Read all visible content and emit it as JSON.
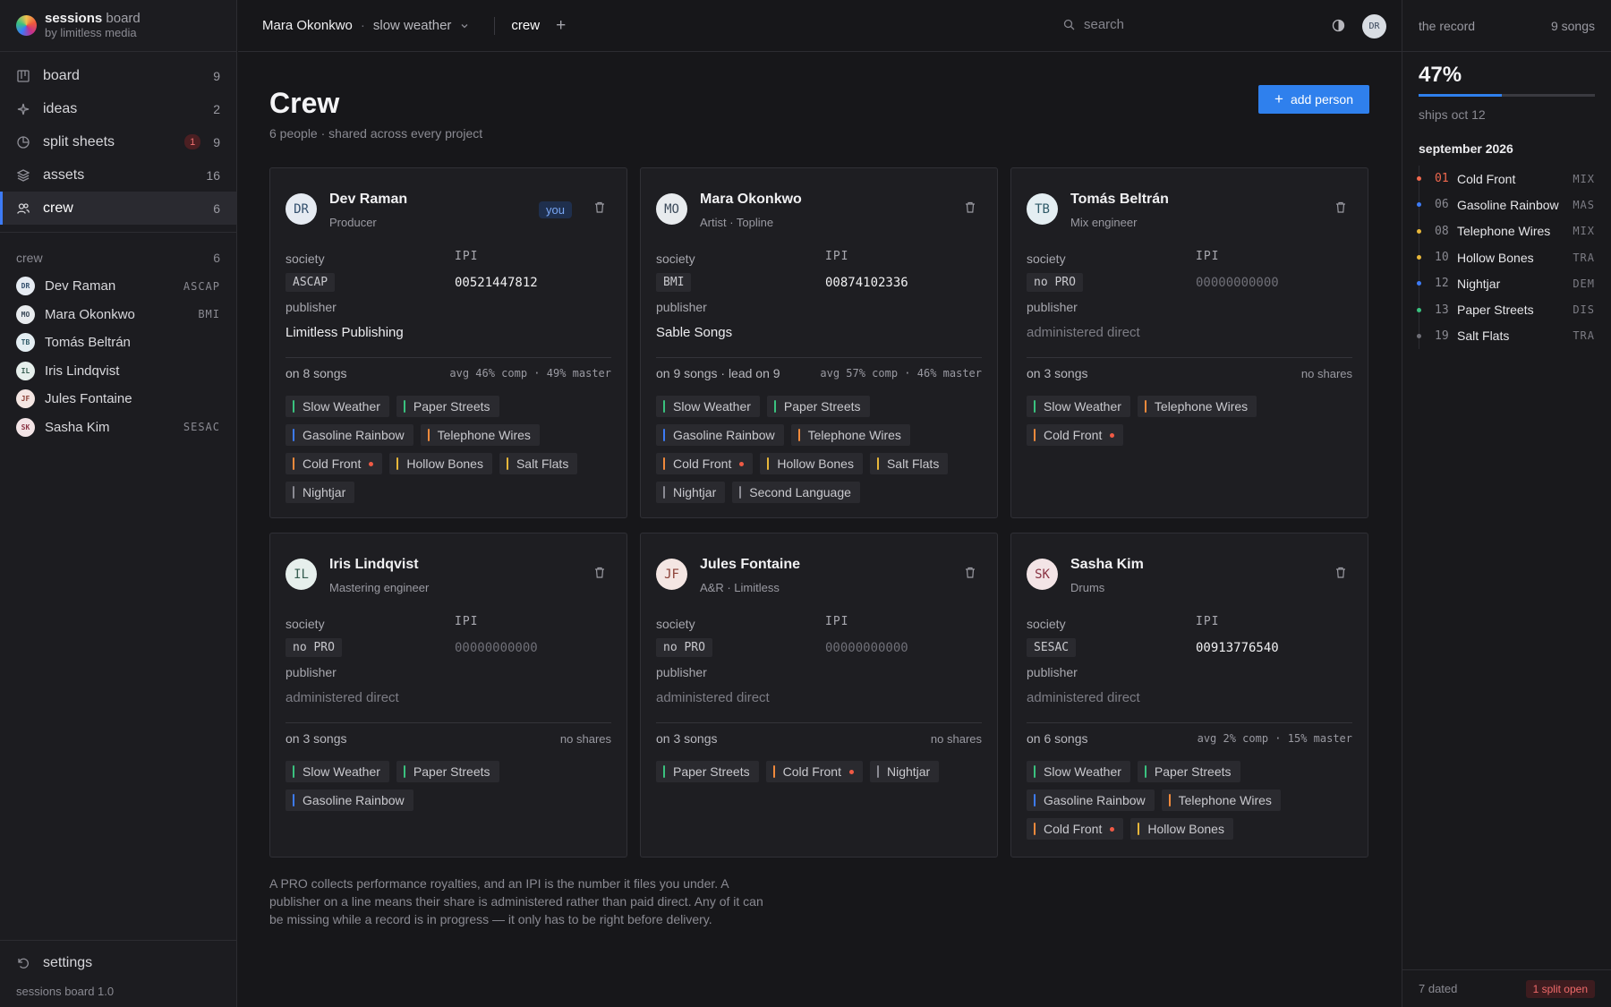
{
  "brand": {
    "name": "sessions",
    "name_suffix": "board",
    "sub": "by limitless media"
  },
  "nav": [
    {
      "key": "board",
      "label": "board",
      "count": "9",
      "icon": "board-icon"
    },
    {
      "key": "ideas",
      "label": "ideas",
      "count": "2",
      "icon": "sparkle-icon"
    },
    {
      "key": "split",
      "label": "split sheets",
      "count": "9",
      "badge": "1",
      "icon": "pie-icon"
    },
    {
      "key": "assets",
      "label": "assets",
      "count": "16",
      "icon": "layers-icon"
    },
    {
      "key": "crew",
      "label": "crew",
      "count": "6",
      "icon": "users-icon",
      "active": true
    }
  ],
  "crew_list": {
    "title": "crew",
    "count": "6",
    "members": [
      {
        "initials": "DR",
        "name": "Dev Raman",
        "society": "ASCAP"
      },
      {
        "initials": "MO",
        "name": "Mara Okonkwo",
        "society": "BMI"
      },
      {
        "initials": "TB",
        "name": "Tomás Beltrán",
        "society": ""
      },
      {
        "initials": "IL",
        "name": "Iris Lindqvist",
        "society": ""
      },
      {
        "initials": "JF",
        "name": "Jules Fontaine",
        "society": ""
      },
      {
        "initials": "SK",
        "name": "Sasha Kim",
        "society": "SESAC"
      }
    ]
  },
  "sidebar_footer": {
    "settings": "settings",
    "version": "sessions board 1.0"
  },
  "topbar": {
    "user": "Mara Okonkwo",
    "project": "slow weather",
    "tab": "crew",
    "search_placeholder": "search",
    "avatar": "DR"
  },
  "page": {
    "title": "Crew",
    "subtitle": "6 people · shared across every project",
    "add_button": "add person",
    "footnote": "A PRO collects performance royalties, and an IPI is the number it files you under. A publisher on a line means their share is administered rather than paid direct. Any of it can be missing while a record is in progress — it only has to be right before delivery."
  },
  "labels": {
    "society": "society",
    "ipi": "IPI",
    "publisher": "publisher",
    "you": "you"
  },
  "colors": {
    "accent": "#2f80ed",
    "song_green": "#3ac27f",
    "song_blue": "#3d7bf5",
    "song_orange": "#f08a3c",
    "song_yellow": "#e8b73a",
    "song_gray": "#8a8a92",
    "open_dot": "#f05a45"
  },
  "people": [
    {
      "initials": "DR",
      "name": "Dev Raman",
      "role": "Producer",
      "you": true,
      "society": "ASCAP",
      "ipi": "00521447812",
      "ipi_empty": false,
      "publisher": "Limitless Publishing",
      "publisher_empty": false,
      "songs_summary": "on 8 songs",
      "shares": "avg 46% comp · 49% master",
      "songs": [
        {
          "title": "Slow Weather",
          "color": "#3ac27f"
        },
        {
          "title": "Paper Streets",
          "color": "#3ac27f"
        },
        {
          "title": "Gasoline Rainbow",
          "color": "#3d7bf5"
        },
        {
          "title": "Telephone Wires",
          "color": "#f08a3c"
        },
        {
          "title": "Cold Front",
          "color": "#f08a3c",
          "open": true
        },
        {
          "title": "Hollow Bones",
          "color": "#e8b73a"
        },
        {
          "title": "Salt Flats",
          "color": "#e8b73a"
        },
        {
          "title": "Nightjar",
          "color": "#8a8a92"
        }
      ]
    },
    {
      "initials": "MO",
      "name": "Mara Okonkwo",
      "role": "Artist · Topline",
      "you": false,
      "society": "BMI",
      "ipi": "00874102336",
      "ipi_empty": false,
      "publisher": "Sable Songs",
      "publisher_empty": false,
      "songs_summary": "on 9 songs · lead on 9",
      "shares": "avg 57% comp · 46% master",
      "songs": [
        {
          "title": "Slow Weather",
          "color": "#3ac27f"
        },
        {
          "title": "Paper Streets",
          "color": "#3ac27f"
        },
        {
          "title": "Gasoline Rainbow",
          "color": "#3d7bf5"
        },
        {
          "title": "Telephone Wires",
          "color": "#f08a3c"
        },
        {
          "title": "Cold Front",
          "color": "#f08a3c",
          "open": true
        },
        {
          "title": "Hollow Bones",
          "color": "#e8b73a"
        },
        {
          "title": "Salt Flats",
          "color": "#e8b73a"
        },
        {
          "title": "Nightjar",
          "color": "#8a8a92"
        },
        {
          "title": "Second Language",
          "color": "#8a8a92"
        }
      ]
    },
    {
      "initials": "TB",
      "name": "Tomás Beltrán",
      "role": "Mix engineer",
      "you": false,
      "society": "no PRO",
      "ipi": "00000000000",
      "ipi_empty": true,
      "publisher": "administered direct",
      "publisher_empty": true,
      "songs_summary": "on 3 songs",
      "shares": "no shares",
      "songs": [
        {
          "title": "Slow Weather",
          "color": "#3ac27f"
        },
        {
          "title": "Telephone Wires",
          "color": "#f08a3c"
        },
        {
          "title": "Cold Front",
          "color": "#f08a3c",
          "open": true
        }
      ]
    },
    {
      "initials": "IL",
      "name": "Iris Lindqvist",
      "role": "Mastering engineer",
      "you": false,
      "society": "no PRO",
      "ipi": "00000000000",
      "ipi_empty": true,
      "publisher": "administered direct",
      "publisher_empty": true,
      "songs_summary": "on 3 songs",
      "shares": "no shares",
      "songs": [
        {
          "title": "Slow Weather",
          "color": "#3ac27f"
        },
        {
          "title": "Paper Streets",
          "color": "#3ac27f"
        },
        {
          "title": "Gasoline Rainbow",
          "color": "#3d7bf5"
        }
      ]
    },
    {
      "initials": "JF",
      "name": "Jules Fontaine",
      "role": "A&R · Limitless",
      "you": false,
      "society": "no PRO",
      "ipi": "00000000000",
      "ipi_empty": true,
      "publisher": "administered direct",
      "publisher_empty": true,
      "songs_summary": "on 3 songs",
      "shares": "no shares",
      "songs": [
        {
          "title": "Paper Streets",
          "color": "#3ac27f"
        },
        {
          "title": "Cold Front",
          "color": "#f08a3c",
          "open": true
        },
        {
          "title": "Nightjar",
          "color": "#8a8a92"
        }
      ]
    },
    {
      "initials": "SK",
      "name": "Sasha Kim",
      "role": "Drums",
      "you": false,
      "society": "SESAC",
      "ipi": "00913776540",
      "ipi_empty": false,
      "publisher": "administered direct",
      "publisher_empty": true,
      "songs_summary": "on 6 songs",
      "shares": "avg 2% comp · 15% master",
      "songs": [
        {
          "title": "Slow Weather",
          "color": "#3ac27f"
        },
        {
          "title": "Paper Streets",
          "color": "#3ac27f"
        },
        {
          "title": "Gasoline Rainbow",
          "color": "#3d7bf5"
        },
        {
          "title": "Telephone Wires",
          "color": "#f08a3c"
        },
        {
          "title": "Cold Front",
          "color": "#f08a3c",
          "open": true
        },
        {
          "title": "Hollow Bones",
          "color": "#e8b73a"
        }
      ]
    }
  ],
  "record": {
    "title": "the record",
    "songs_count": "9 songs",
    "progress_label": "47%",
    "progress": 0.47,
    "ships": "ships oct 12",
    "month": "september 2026",
    "schedule": [
      {
        "num": "01",
        "title": "Cold Front",
        "stage": "MIX",
        "dot": "#f0684e",
        "hot": true
      },
      {
        "num": "06",
        "title": "Gasoline Rainbow",
        "stage": "MAS",
        "dot": "#3d7bf5"
      },
      {
        "num": "08",
        "title": "Telephone Wires",
        "stage": "MIX",
        "dot": "#e8b73a"
      },
      {
        "num": "10",
        "title": "Hollow Bones",
        "stage": "TRA",
        "dot": "#e8b73a"
      },
      {
        "num": "12",
        "title": "Nightjar",
        "stage": "DEM",
        "dot": "#3d7bf5"
      },
      {
        "num": "13",
        "title": "Paper Streets",
        "stage": "DIS",
        "dot": "#3ac27f"
      },
      {
        "num": "19",
        "title": "Salt Flats",
        "stage": "TRA",
        "dot": "#6f6f77"
      }
    ],
    "dated": "7 dated",
    "split_open": "1 split open"
  }
}
